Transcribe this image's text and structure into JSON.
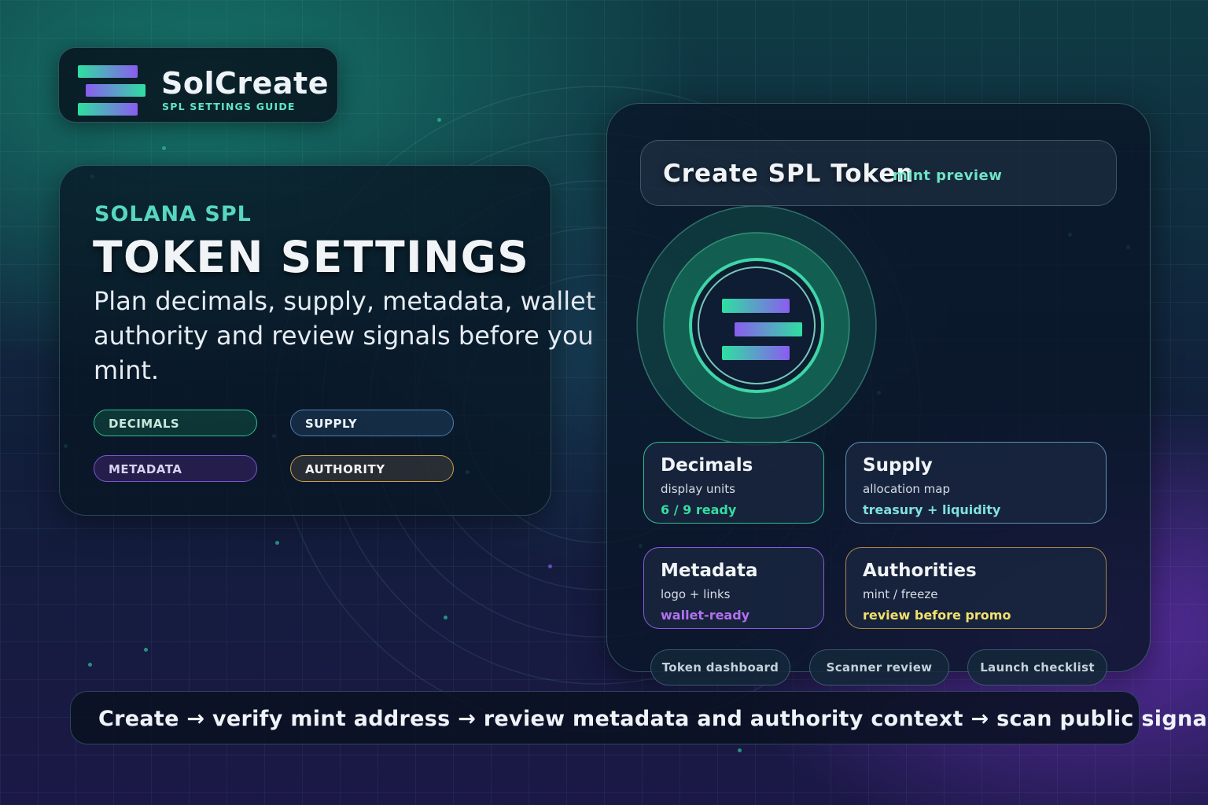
{
  "brand": {
    "name": "SolCreate",
    "subtitle": "SPL SETTINGS GUIDE",
    "logo_icon": "solana-bars-icon"
  },
  "intro": {
    "eyebrow": "SOLANA SPL",
    "headline": "TOKEN SETTINGS",
    "lede": "Plan decimals, supply, metadata, wallet authority and review signals before you mint.",
    "chips": [
      {
        "label": "DECIMALS",
        "color": "#2fbf8f"
      },
      {
        "label": "SUPPLY",
        "color": "#4d7fb0"
      },
      {
        "label": "METADATA",
        "color": "#7a55d0"
      },
      {
        "label": "AUTHORITY",
        "color": "#c9a04a"
      }
    ]
  },
  "preview": {
    "title": "Create SPL Token",
    "tag": "mint preview",
    "cards": [
      {
        "title": "Decimals",
        "subtitle": "display units",
        "status": "6 / 9 ready",
        "accent": "#37dca2"
      },
      {
        "title": "Supply",
        "subtitle": "allocation map",
        "status": "treasury + liquidity",
        "accent": "#7fe2de"
      },
      {
        "title": "Metadata",
        "subtitle": "logo + links",
        "status": "wallet-ready",
        "accent": "#b270f0"
      },
      {
        "title": "Authorities",
        "subtitle": "mint / freeze",
        "status": "review before promo",
        "accent": "#f2e06a"
      }
    ],
    "links": [
      {
        "label": "Token dashboard"
      },
      {
        "label": "Scanner review"
      },
      {
        "label": "Launch checklist"
      }
    ]
  },
  "flow": {
    "text": "Create → verify mint address → review metadata and authority context → scan public signals"
  }
}
